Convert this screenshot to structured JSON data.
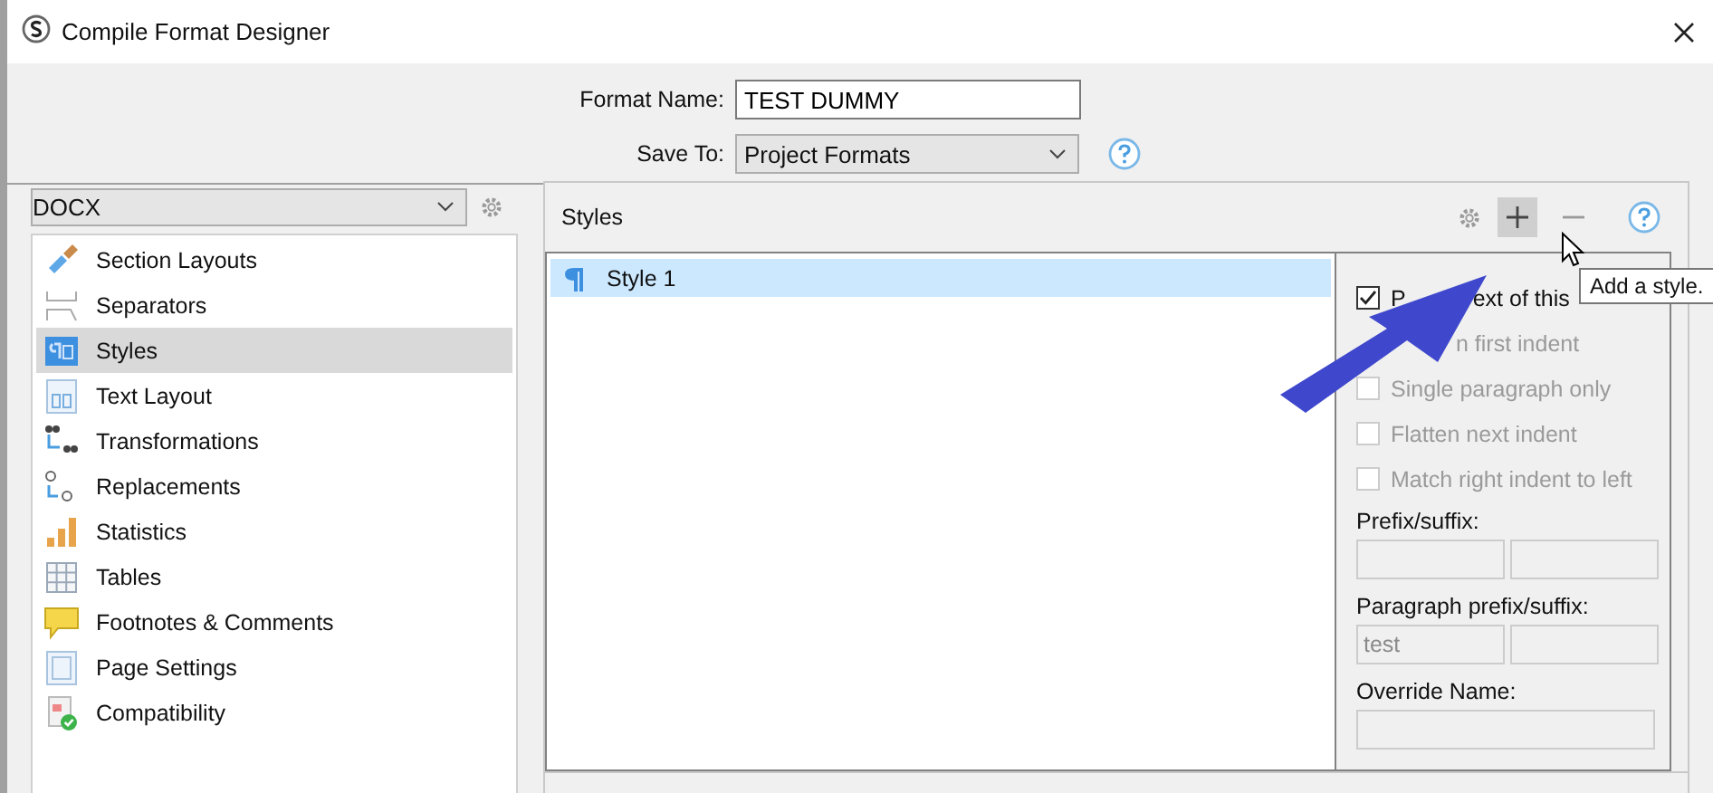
{
  "window": {
    "title": "Compile Format Designer"
  },
  "format_name": {
    "label": "Format Name:",
    "value": "TEST DUMMY"
  },
  "save_to": {
    "label": "Save To:",
    "value": "Project Formats"
  },
  "format_select": {
    "value": "DOCX"
  },
  "sidebar": {
    "items": [
      {
        "label": "Section Layouts",
        "selected": false
      },
      {
        "label": "Separators",
        "selected": false
      },
      {
        "label": "Styles",
        "selected": true
      },
      {
        "label": "Text Layout",
        "selected": false
      },
      {
        "label": "Transformations",
        "selected": false
      },
      {
        "label": "Replacements",
        "selected": false
      },
      {
        "label": "Statistics",
        "selected": false
      },
      {
        "label": "Tables",
        "selected": false
      },
      {
        "label": "Footnotes & Comments",
        "selected": false
      },
      {
        "label": "Page Settings",
        "selected": false
      },
      {
        "label": "Compatibility",
        "selected": false
      }
    ]
  },
  "styles_panel": {
    "title": "Styles",
    "styles": [
      {
        "label": "Style 1",
        "selected": true
      }
    ],
    "options": [
      {
        "kind": "checkbox",
        "checked": true,
        "disabled": false,
        "parts": [
          "P",
          "ext of this"
        ]
      },
      {
        "kind": "covered",
        "disabled": true,
        "parts": [
          "n first indent"
        ]
      },
      {
        "kind": "checkbox",
        "checked": false,
        "disabled": true,
        "parts": [
          "Single paragraph only"
        ]
      },
      {
        "kind": "checkbox",
        "checked": false,
        "disabled": true,
        "parts": [
          "Flatten next indent"
        ]
      },
      {
        "kind": "checkbox",
        "checked": false,
        "disabled": true,
        "parts": [
          "Match right indent to left"
        ]
      }
    ],
    "prefix_suffix": {
      "label": "Prefix/suffix:"
    },
    "paragraph_prefix_suffix": {
      "label": "Paragraph prefix/suffix:",
      "prefix": "test"
    },
    "override_name": {
      "label": "Override Name:"
    }
  },
  "tooltip": "Add a style."
}
